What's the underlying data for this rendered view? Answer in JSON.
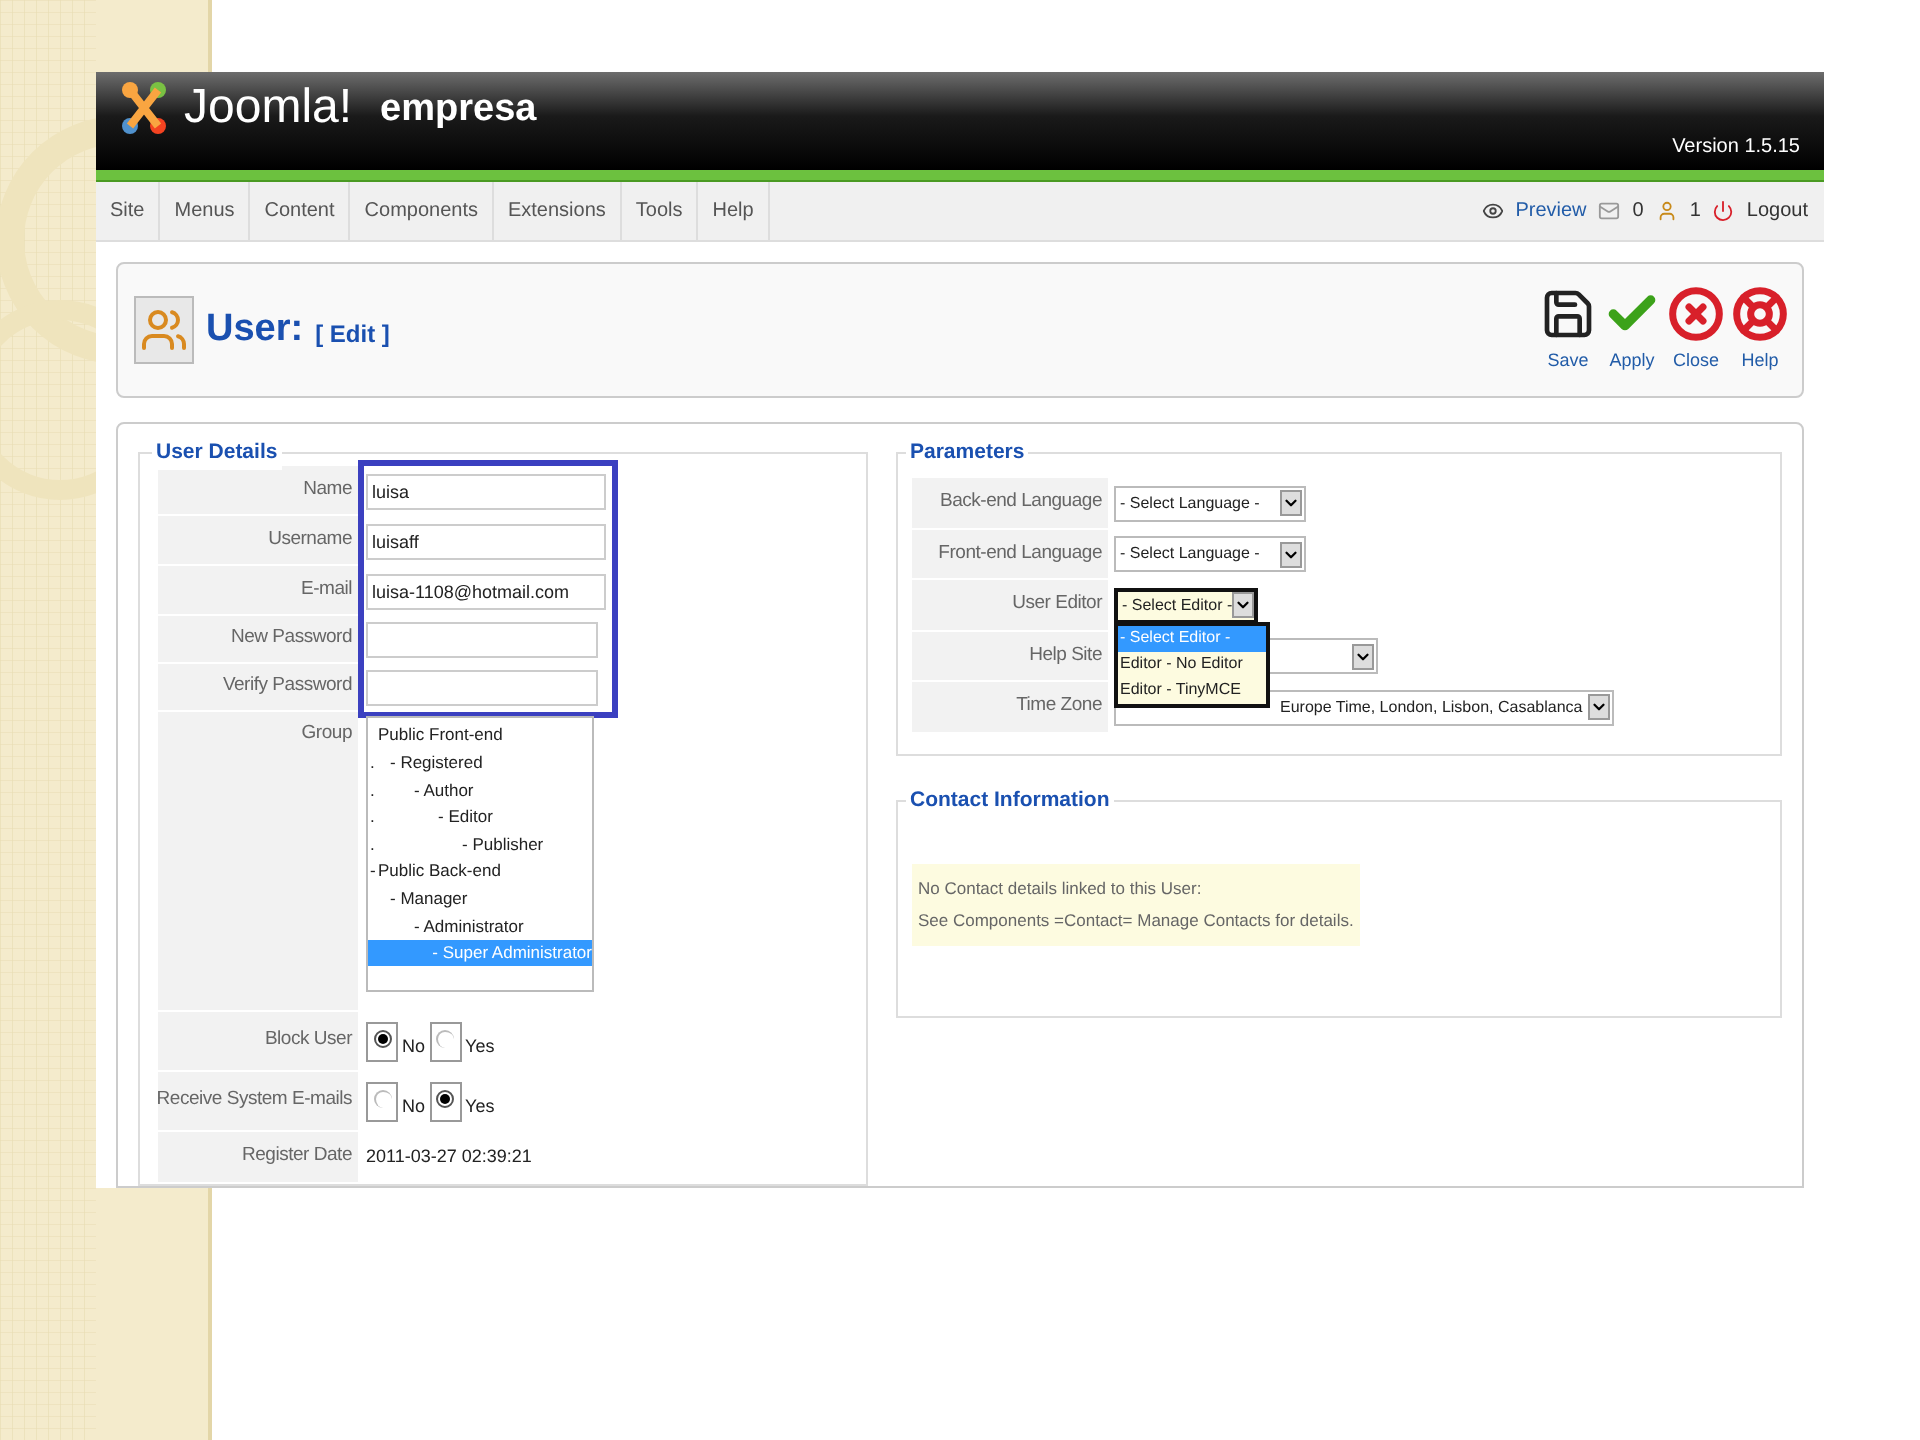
{
  "header": {
    "logo_text": "Joomla!",
    "site_name": "empresa",
    "version": "Version 1.5.15"
  },
  "menu": [
    {
      "label": "Site"
    },
    {
      "label": "Menus"
    },
    {
      "label": "Content"
    },
    {
      "label": "Components"
    },
    {
      "label": "Extensions"
    },
    {
      "label": "Tools"
    },
    {
      "label": "Help"
    }
  ],
  "status": {
    "preview": "Preview",
    "messages": "0",
    "users": "1",
    "logout": "Logout"
  },
  "toolbar": {
    "title": "User:",
    "subtitle": "[ Edit ]",
    "buttons": [
      {
        "kind": "save",
        "label": "Save"
      },
      {
        "kind": "apply",
        "label": "Apply"
      },
      {
        "kind": "close",
        "label": "Close"
      },
      {
        "kind": "help",
        "label": "Help"
      }
    ]
  },
  "user_details": {
    "legend": "User Details",
    "annotated_fields": [
      {
        "label": "Name",
        "kind": "text",
        "value": "luisa"
      },
      {
        "label": "Username",
        "kind": "text",
        "value": "luisaff"
      },
      {
        "label": "E-mail",
        "kind": "text",
        "value": "luisa-1108@hotmail.com"
      },
      {
        "label": "New Password",
        "kind": "password"
      },
      {
        "label": "Verify Password",
        "kind": "password"
      }
    ],
    "fields": [
      {
        "label": "Group",
        "kind": "group",
        "options": [
          {
            "label": "Public Front-end",
            "selected": false,
            "children": [
              {
                "lead": ".",
                "label": "- Registered",
                "selected": false,
                "children": [
                  {
                    "lead": ".",
                    "label": "- Author",
                    "selected": false,
                    "children": [
                      {
                        "lead": ".",
                        "label": "- Editor",
                        "selected": false,
                        "children": [
                          {
                            "lead": ".",
                            "label": "- Publisher",
                            "selected": false
                          }
                        ]
                      }
                    ]
                  }
                ]
              }
            ]
          },
          {
            "lead": "-",
            "label": "Public Back-end",
            "selected": false,
            "children": [
              {
                "label": "- Manager",
                "selected": false,
                "children": [
                  {
                    "label": "- Administrator",
                    "selected": false,
                    "children": [
                      {
                        "label": "- Super Administrator",
                        "selected": true
                      }
                    ]
                  }
                ]
              }
            ]
          }
        ]
      },
      {
        "label": "Block User",
        "kind": "radio",
        "options": [
          {
            "label": "No",
            "selected": true
          },
          {
            "label": "Yes",
            "selected": false
          }
        ]
      },
      {
        "label": "Receive System E-mails",
        "kind": "radio",
        "options": [
          {
            "label": "No",
            "selected": false
          },
          {
            "label": "Yes",
            "selected": true
          }
        ]
      },
      {
        "label": "Register Date",
        "kind": "date",
        "value": "2011-03-27 02:39:21"
      }
    ]
  },
  "parameters": {
    "legend": "Parameters",
    "fields": [
      {
        "label": "Back-end Language",
        "value": "- Select Language -"
      },
      {
        "label": "Front-end Language",
        "value": "- Select Language -"
      },
      {
        "label": "User Editor",
        "value": "- Select Editor -",
        "open": true,
        "options": [
          {
            "label": "- Select Editor -",
            "selected": true
          },
          {
            "label": "Editor - No Editor",
            "selected": false
          },
          {
            "label": "Editor - TinyMCE",
            "selected": false
          }
        ]
      },
      {
        "label": "Help Site",
        "open": false
      },
      {
        "label": "Time Zone",
        "value": "Europe Time, London, Lisbon, Casablanca"
      }
    ]
  },
  "contact": {
    "legend": "Contact Information",
    "lines": [
      "No Contact details linked to this User:",
      "See Components =Contact= Manage Contacts for details."
    ]
  }
}
